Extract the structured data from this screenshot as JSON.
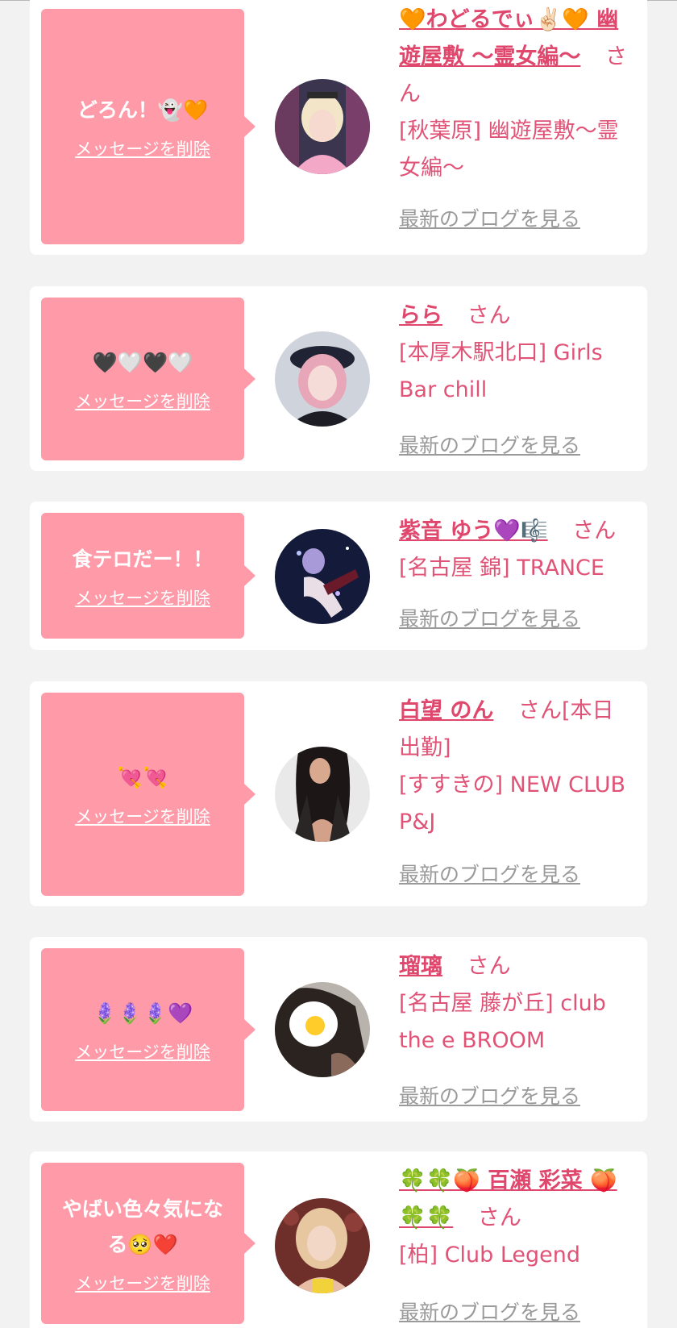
{
  "delete_label": "メッセージを削除",
  "blog_label": "最新のブログを見る",
  "san": "さん",
  "cards": [
    {
      "message": "どろん！👻🧡",
      "name": "🧡わどるでぃ✌🏻🧡 幽遊屋敷 ～霊女編～",
      "suffix": "さん",
      "shop": "[秋葉原] 幽遊屋敷～霊女編～"
    },
    {
      "message": "🖤🤍🖤🤍",
      "name": "らら",
      "suffix": "さん",
      "shop": "[本厚木駅北口] Girls Bar chill"
    },
    {
      "message": "食テロだー！！",
      "name": "紫音 ゆう💜🎼",
      "suffix": "さん",
      "shop": "[名古屋 錦] TRANCE"
    },
    {
      "message": "💘💘",
      "name": "白望 のん",
      "suffix": "さん[本日出勤]",
      "shop": "[すすきの] NEW CLUB P&J"
    },
    {
      "message": "🪻🪻🪻💜",
      "name": "瑠璃",
      "suffix": "さん",
      "shop": "[名古屋 藤が丘] club the e BROOM"
    },
    {
      "message": "やばい色々気になる🥺❤️",
      "name": "🍀🍀🍑 百瀬 彩菜 🍑🍀🍀",
      "suffix": "さん",
      "shop": "[柏] Club Legend"
    }
  ],
  "colors": {
    "background": "#f2f2f2",
    "bubble": "#ff9aa8",
    "accent": "#e0476d",
    "link_gray": "#9a9a9a"
  }
}
